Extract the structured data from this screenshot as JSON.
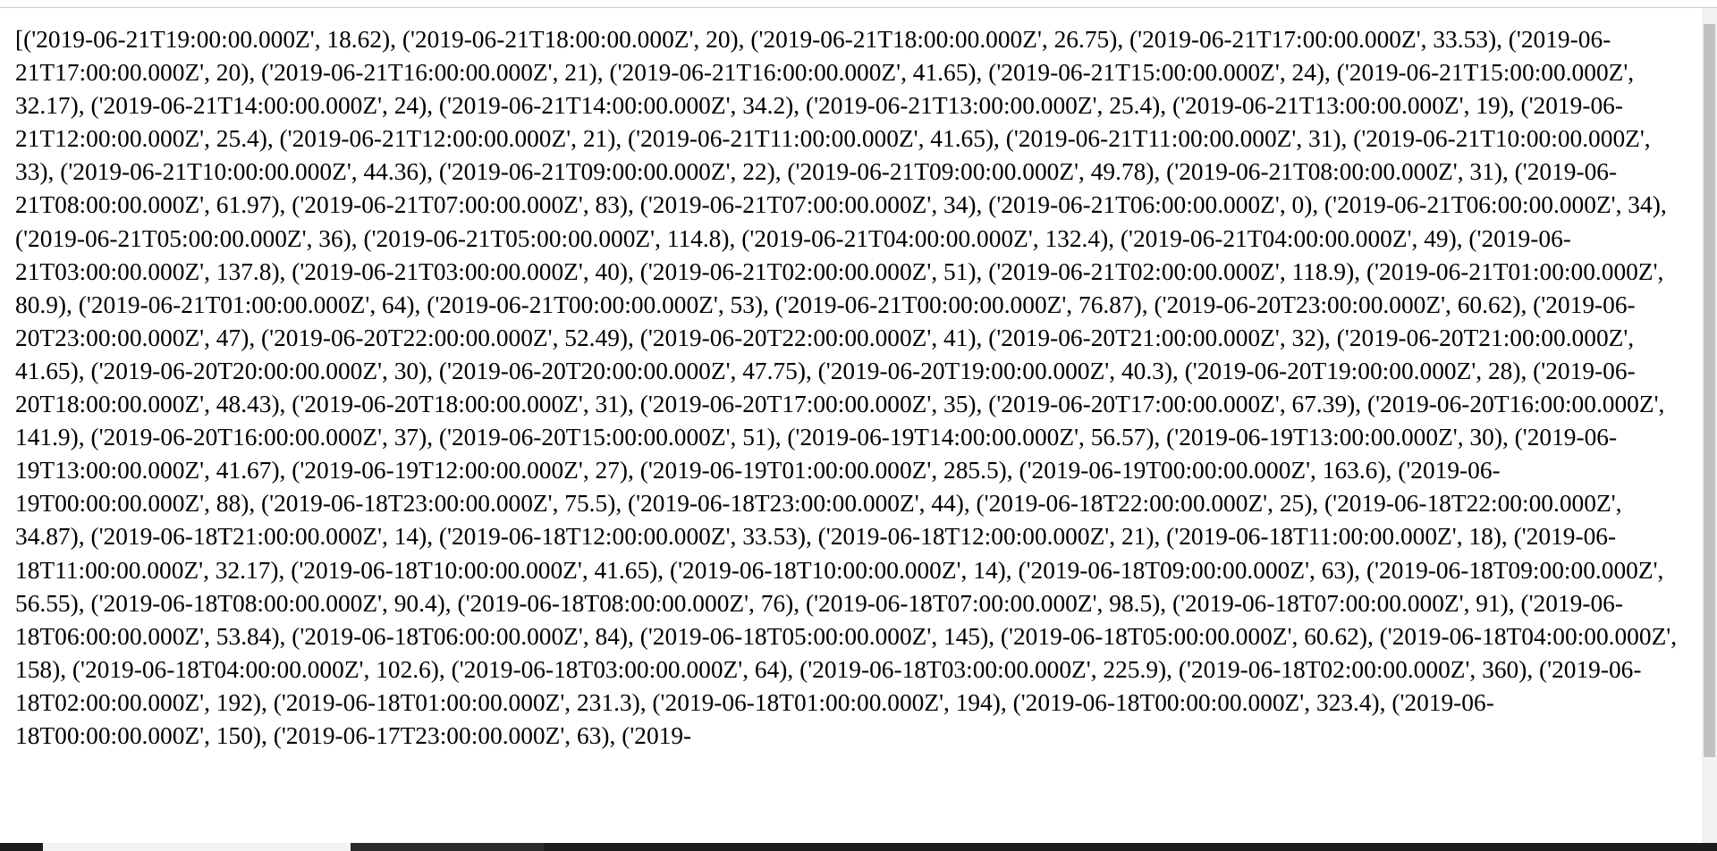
{
  "document": {
    "text": "[('2019-06-21T19:00:00.000Z', 18.62), ('2019-06-21T18:00:00.000Z', 20), ('2019-06-21T18:00:00.000Z', 26.75), ('2019-06-21T17:00:00.000Z', 33.53), ('2019-06-21T17:00:00.000Z', 20), ('2019-06-21T16:00:00.000Z', 21), ('2019-06-21T16:00:00.000Z', 41.65), ('2019-06-21T15:00:00.000Z', 24), ('2019-06-21T15:00:00.000Z', 32.17), ('2019-06-21T14:00:00.000Z', 24), ('2019-06-21T14:00:00.000Z', 34.2), ('2019-06-21T13:00:00.000Z', 25.4), ('2019-06-21T13:00:00.000Z', 19), ('2019-06-21T12:00:00.000Z', 25.4), ('2019-06-21T12:00:00.000Z', 21), ('2019-06-21T11:00:00.000Z', 41.65), ('2019-06-21T11:00:00.000Z', 31), ('2019-06-21T10:00:00.000Z', 33), ('2019-06-21T10:00:00.000Z', 44.36), ('2019-06-21T09:00:00.000Z', 22), ('2019-06-21T09:00:00.000Z', 49.78), ('2019-06-21T08:00:00.000Z', 31), ('2019-06-21T08:00:00.000Z', 61.97), ('2019-06-21T07:00:00.000Z', 83), ('2019-06-21T07:00:00.000Z', 34), ('2019-06-21T06:00:00.000Z', 0), ('2019-06-21T06:00:00.000Z', 34), ('2019-06-21T05:00:00.000Z', 36), ('2019-06-21T05:00:00.000Z', 114.8), ('2019-06-21T04:00:00.000Z', 132.4), ('2019-06-21T04:00:00.000Z', 49), ('2019-06-21T03:00:00.000Z', 137.8), ('2019-06-21T03:00:00.000Z', 40), ('2019-06-21T02:00:00.000Z', 51), ('2019-06-21T02:00:00.000Z', 118.9), ('2019-06-21T01:00:00.000Z', 80.9), ('2019-06-21T01:00:00.000Z', 64), ('2019-06-21T00:00:00.000Z', 53), ('2019-06-21T00:00:00.000Z', 76.87), ('2019-06-20T23:00:00.000Z', 60.62), ('2019-06-20T23:00:00.000Z', 47), ('2019-06-20T22:00:00.000Z', 52.49), ('2019-06-20T22:00:00.000Z', 41), ('2019-06-20T21:00:00.000Z', 32), ('2019-06-20T21:00:00.000Z', 41.65), ('2019-06-20T20:00:00.000Z', 30), ('2019-06-20T20:00:00.000Z', 47.75), ('2019-06-20T19:00:00.000Z', 40.3), ('2019-06-20T19:00:00.000Z', 28), ('2019-06-20T18:00:00.000Z', 48.43), ('2019-06-20T18:00:00.000Z', 31), ('2019-06-20T17:00:00.000Z', 35), ('2019-06-20T17:00:00.000Z', 67.39), ('2019-06-20T16:00:00.000Z', 141.9), ('2019-06-20T16:00:00.000Z', 37), ('2019-06-20T15:00:00.000Z', 51), ('2019-06-19T14:00:00.000Z', 56.57), ('2019-06-19T13:00:00.000Z', 30), ('2019-06-19T13:00:00.000Z', 41.67), ('2019-06-19T12:00:00.000Z', 27), ('2019-06-19T01:00:00.000Z', 285.5), ('2019-06-19T00:00:00.000Z', 163.6), ('2019-06-19T00:00:00.000Z', 88), ('2019-06-18T23:00:00.000Z', 75.5), ('2019-06-18T23:00:00.000Z', 44), ('2019-06-18T22:00:00.000Z', 25), ('2019-06-18T22:00:00.000Z', 34.87), ('2019-06-18T21:00:00.000Z', 14), ('2019-06-18T12:00:00.000Z', 33.53), ('2019-06-18T12:00:00.000Z', 21), ('2019-06-18T11:00:00.000Z', 18), ('2019-06-18T11:00:00.000Z', 32.17), ('2019-06-18T10:00:00.000Z', 41.65), ('2019-06-18T10:00:00.000Z', 14), ('2019-06-18T09:00:00.000Z', 63), ('2019-06-18T09:00:00.000Z', 56.55), ('2019-06-18T08:00:00.000Z', 90.4), ('2019-06-18T08:00:00.000Z', 76), ('2019-06-18T07:00:00.000Z', 98.5), ('2019-06-18T07:00:00.000Z', 91), ('2019-06-18T06:00:00.000Z', 53.84), ('2019-06-18T06:00:00.000Z', 84), ('2019-06-18T05:00:00.000Z', 145), ('2019-06-18T05:00:00.000Z', 60.62), ('2019-06-18T04:00:00.000Z', 158), ('2019-06-18T04:00:00.000Z', 102.6), ('2019-06-18T03:00:00.000Z', 64), ('2019-06-18T03:00:00.000Z', 225.9), ('2019-06-18T02:00:00.000Z', 360), ('2019-06-18T02:00:00.000Z', 192), ('2019-06-18T01:00:00.000Z', 231.3), ('2019-06-18T01:00:00.000Z', 194), ('2019-06-18T00:00:00.000Z', 323.4), ('2019-06-18T00:00:00.000Z', 150), ('2019-06-17T23:00:00.000Z', 63), ('2019-"
  },
  "colors": {
    "background": "#ffffff",
    "text": "#000000",
    "scrollbar_track": "#f1f1f1",
    "scrollbar_thumb": "#c1c1c1",
    "taskbar": "#1d1d1d"
  }
}
